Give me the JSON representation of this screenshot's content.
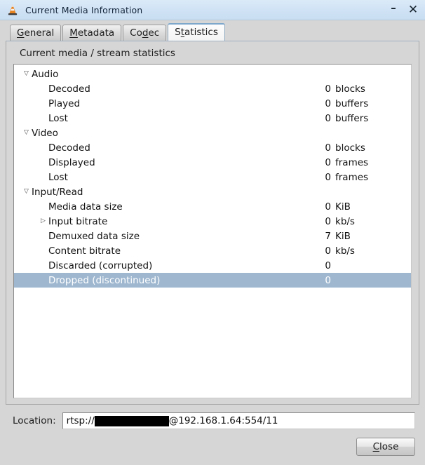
{
  "window": {
    "title": "Current Media Information",
    "icon": "vlc-cone-icon",
    "minimize_label": "–",
    "close_label": "✕"
  },
  "tabs": [
    {
      "label_before": "",
      "mnemonic": "G",
      "label_after": "eneral",
      "active": false,
      "name": "tab-general"
    },
    {
      "label_before": "",
      "mnemonic": "M",
      "label_after": "etadata",
      "active": false,
      "name": "tab-metadata"
    },
    {
      "label_before": "Co",
      "mnemonic": "d",
      "label_after": "ec",
      "active": false,
      "name": "tab-codec"
    },
    {
      "label_before": "S",
      "mnemonic": "t",
      "label_after": "atistics",
      "active": true,
      "name": "tab-statistics"
    }
  ],
  "statistics": {
    "heading": "Current media / stream statistics",
    "rows": [
      {
        "type": "group",
        "arrow": "▽",
        "label": "Audio",
        "value": "",
        "unit": "",
        "selected": false
      },
      {
        "type": "child",
        "arrow": "",
        "label": "Decoded",
        "value": "0",
        "unit": "blocks",
        "selected": false
      },
      {
        "type": "child",
        "arrow": "",
        "label": "Played",
        "value": "0",
        "unit": "buffers",
        "selected": false
      },
      {
        "type": "child",
        "arrow": "",
        "label": "Lost",
        "value": "0",
        "unit": "buffers",
        "selected": false
      },
      {
        "type": "group",
        "arrow": "▽",
        "label": "Video",
        "value": "",
        "unit": "",
        "selected": false
      },
      {
        "type": "child",
        "arrow": "",
        "label": "Decoded",
        "value": "0",
        "unit": "blocks",
        "selected": false
      },
      {
        "type": "child",
        "arrow": "",
        "label": "Displayed",
        "value": "0",
        "unit": "frames",
        "selected": false
      },
      {
        "type": "child",
        "arrow": "",
        "label": "Lost",
        "value": "0",
        "unit": "frames",
        "selected": false
      },
      {
        "type": "group",
        "arrow": "▽",
        "label": "Input/Read",
        "value": "",
        "unit": "",
        "selected": false
      },
      {
        "type": "child",
        "arrow": "",
        "label": "Media data size",
        "value": "0",
        "unit": "KiB",
        "selected": false
      },
      {
        "type": "child",
        "arrow": "▷",
        "label": "Input bitrate",
        "value": "0",
        "unit": "kb/s",
        "selected": false
      },
      {
        "type": "child",
        "arrow": "",
        "label": "Demuxed data size",
        "value": "7",
        "unit": "KiB",
        "selected": false
      },
      {
        "type": "child",
        "arrow": "",
        "label": "Content bitrate",
        "value": "0",
        "unit": "kb/s",
        "selected": false
      },
      {
        "type": "child",
        "arrow": "",
        "label": "Discarded (corrupted)",
        "value": "0",
        "unit": "",
        "selected": false
      },
      {
        "type": "child",
        "arrow": "",
        "label": "Dropped (discontinued)",
        "value": "0",
        "unit": "",
        "selected": true
      }
    ]
  },
  "location": {
    "label": "Location:",
    "value_prefix": "rtsp://",
    "value_redacted": true,
    "value_suffix": "@192.168.1.64:554/11"
  },
  "footer": {
    "close_mnemonic": "C",
    "close_label_after": "lose"
  },
  "colors": {
    "selection": "#9fb8d0",
    "titlebar": "#cfe2f5",
    "dialog_bg": "#d6d6d6",
    "tree_bg": "#ffffff"
  }
}
